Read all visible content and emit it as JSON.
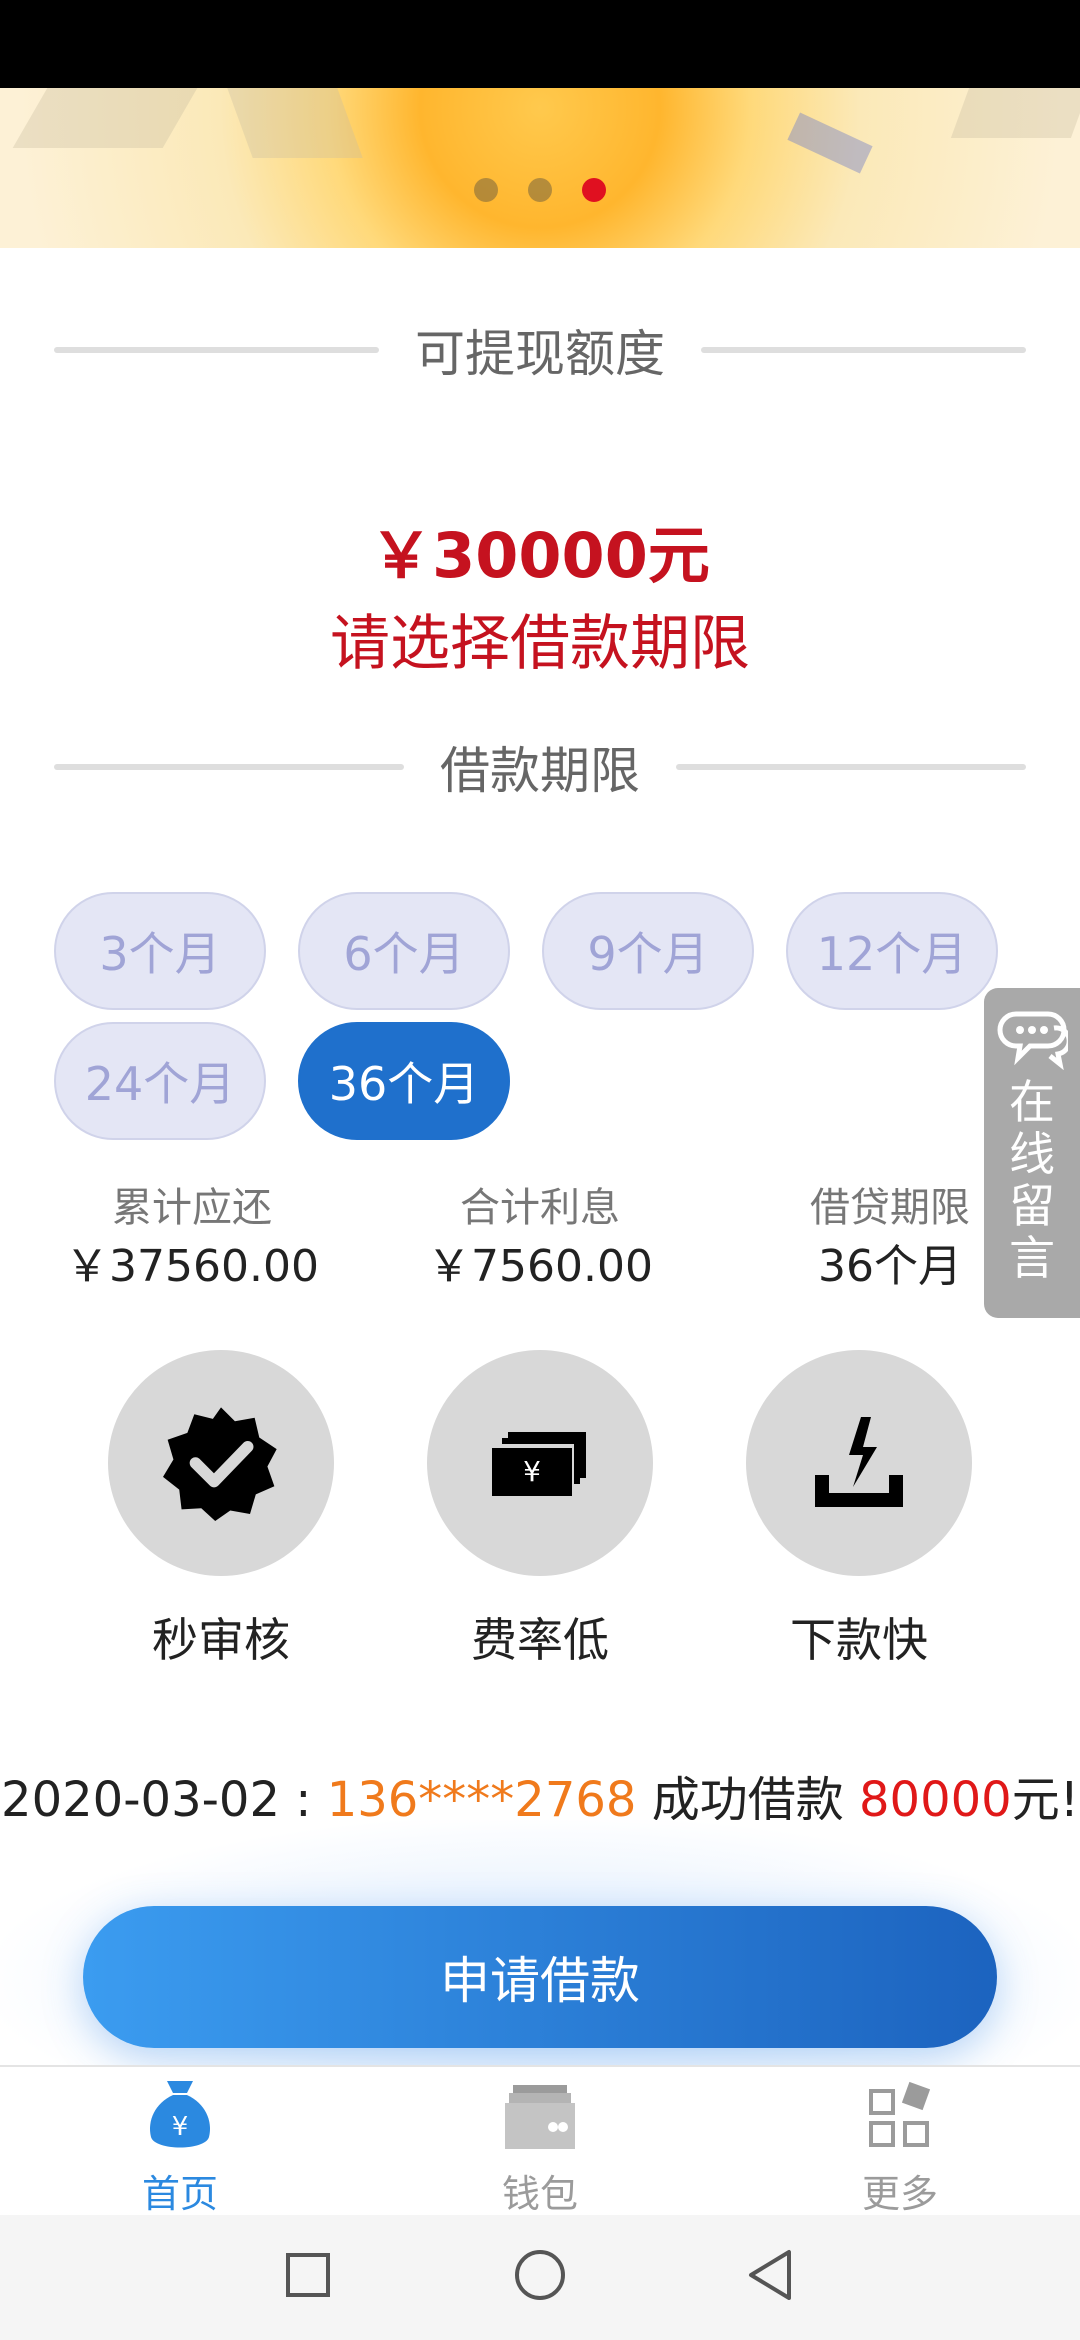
{
  "banner": {
    "slide_count": 3,
    "active_index": 2
  },
  "withdraw_header": "可提现额度",
  "amount": "￥30000元",
  "prompt": "请选择借款期限",
  "term_header": "借款期限",
  "terms": [
    "3个月",
    "6个月",
    "9个月",
    "12个月",
    "24个月",
    "36个月"
  ],
  "selected_term_index": 5,
  "summary": [
    {
      "label": "累计应还",
      "value": "￥37560.00"
    },
    {
      "label": "合计利息",
      "value": "￥7560.00"
    },
    {
      "label": "借贷期限",
      "value": "36个月"
    }
  ],
  "features": [
    {
      "label": "秒审核",
      "icon": "verified-badge-icon"
    },
    {
      "label": "费率低",
      "icon": "money-stack-icon"
    },
    {
      "label": "下款快",
      "icon": "fast-download-icon"
    }
  ],
  "notice": {
    "date": "2020-03-02 : ",
    "phone": "136****2768",
    "middle": " 成功借款 ",
    "amount": "80000",
    "suffix": "元!"
  },
  "apply_button": "申请借款",
  "side_chat": "在线留言",
  "tabs": [
    {
      "label": "首页",
      "icon": "money-bag-icon",
      "active": true
    },
    {
      "label": "钱包",
      "icon": "wallet-icon",
      "active": false
    },
    {
      "label": "更多",
      "icon": "grid-more-icon",
      "active": false
    }
  ],
  "colors": {
    "accent_red": "#c5121f",
    "primary_blue": "#1f70cc",
    "phone_orange": "#f07a1c"
  }
}
